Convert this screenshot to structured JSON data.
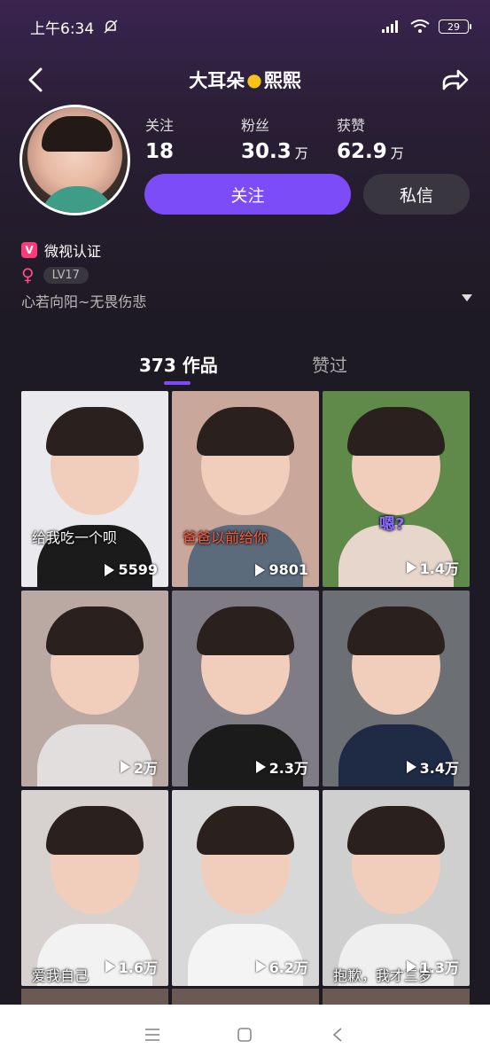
{
  "status_bar": {
    "time": "上午6:34",
    "battery": "29"
  },
  "nav": {
    "title_left": "大耳朵",
    "title_right": "熙熙"
  },
  "stats": [
    {
      "label": "关注",
      "value": "18",
      "unit": ""
    },
    {
      "label": "粉丝",
      "value": "30.3",
      "unit": "万"
    },
    {
      "label": "获赞",
      "value": "62.9",
      "unit": "万"
    }
  ],
  "actions": {
    "follow": "关注",
    "message": "私信"
  },
  "profile": {
    "verify": "微视认证",
    "level": "LV17",
    "bio": "心若向阳~无畏伤悲"
  },
  "tabs": {
    "works": "373 作品",
    "liked": "赞过"
  },
  "videos": [
    {
      "plays": "5599",
      "caption": "给我吃一个呗",
      "caption_style": "white",
      "bg": "#e9e9ee",
      "shirt": "#1b1b1b"
    },
    {
      "plays": "9801",
      "caption": "爸爸以前给你",
      "caption_style": "red",
      "bg": "#c9a79a",
      "shirt": "#5b6b7c"
    },
    {
      "plays": "1.4万",
      "caption": "嗯?",
      "caption_style": "purple",
      "bg": "#5f8a4a",
      "shirt": "#e7d6cc"
    },
    {
      "plays": "2万",
      "caption": "",
      "caption_style": "white",
      "bg": "#b9a9a2",
      "shirt": "#e3dede"
    },
    {
      "plays": "2.3万",
      "caption": "",
      "caption_style": "white",
      "bg": "#7f7c86",
      "shirt": "#1b1b1b"
    },
    {
      "plays": "3.4万",
      "caption": "",
      "caption_style": "white",
      "bg": "#6c6f73",
      "shirt": "#1f2a44"
    },
    {
      "plays": "1.6万",
      "caption": "爱我自己",
      "caption_style": "white",
      "bg": "#d7d2d0",
      "shirt": "#f2f2f2"
    },
    {
      "plays": "6.2万",
      "caption": "",
      "caption_style": "white",
      "bg": "#d8d8d8",
      "shirt": "#f4f4f4"
    },
    {
      "plays": "1.3万",
      "caption": "抱歉，我才三岁",
      "caption_style": "white",
      "bg": "#cfcfcf",
      "shirt": "#efefef"
    }
  ],
  "colors": {
    "accent": "#7b4cf7",
    "background": "#1e1a24",
    "gender": "#ff4a8a"
  }
}
